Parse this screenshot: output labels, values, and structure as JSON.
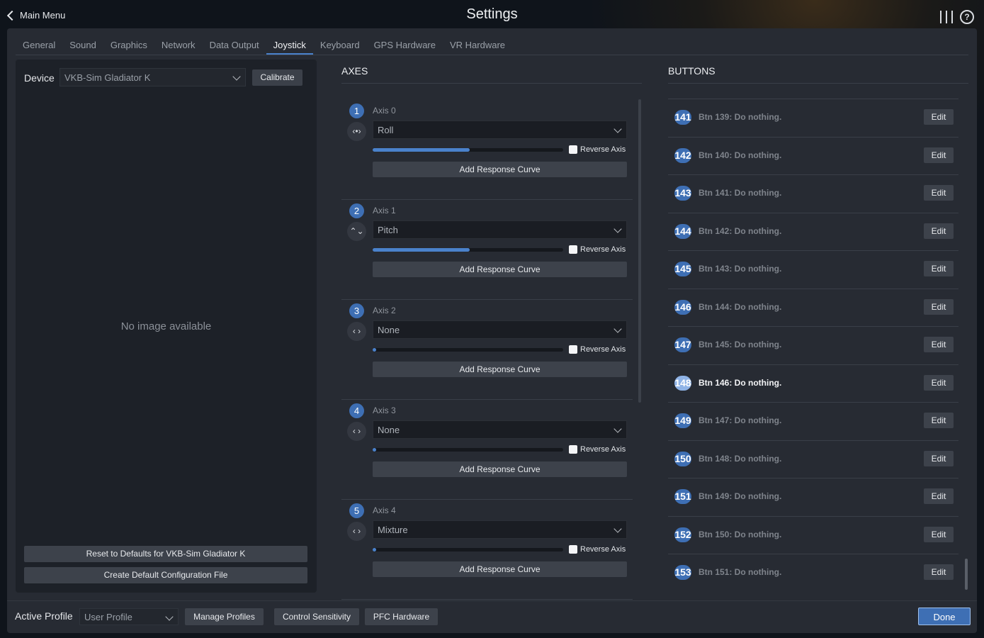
{
  "header": {
    "back_label": "Main Menu",
    "title": "Settings",
    "icons": [
      "sliders-icon",
      "help-icon"
    ]
  },
  "tabs": [
    {
      "label": "General",
      "active": false
    },
    {
      "label": "Sound",
      "active": false
    },
    {
      "label": "Graphics",
      "active": false
    },
    {
      "label": "Network",
      "active": false
    },
    {
      "label": "Data Output",
      "active": false
    },
    {
      "label": "Joystick",
      "active": true
    },
    {
      "label": "Keyboard",
      "active": false
    },
    {
      "label": "GPS Hardware",
      "active": false
    },
    {
      "label": "VR Hardware",
      "active": false
    }
  ],
  "device": {
    "label": "Device",
    "selected": "VKB-Sim Gladiator K",
    "calibrate_label": "Calibrate",
    "no_image": "No image available",
    "reset_label": "Reset to Defaults for VKB-Sim Gladiator K",
    "create_label": "Create Default Configuration File"
  },
  "axes": {
    "heading": "AXES",
    "reverse_label": "Reverse Axis",
    "curve_label": "Add Response Curve",
    "items": [
      {
        "num": "1",
        "name": "Axis 0",
        "dir": "‹•›",
        "value": "Roll",
        "level": 0.51
      },
      {
        "num": "2",
        "name": "Axis 1",
        "dir": "⌃⌄",
        "value": "Pitch",
        "level": 0.51
      },
      {
        "num": "3",
        "name": "Axis 2",
        "dir": "‹ ›",
        "value": "None",
        "level": 0.02
      },
      {
        "num": "4",
        "name": "Axis 3",
        "dir": "‹ ›",
        "value": "None",
        "level": 0.02
      },
      {
        "num": "5",
        "name": "Axis 4",
        "dir": "‹ ›",
        "value": "Mixture",
        "level": 0.02
      }
    ]
  },
  "buttons": {
    "heading": "BUTTONS",
    "edit_label": "Edit",
    "items": [
      {
        "num": "141",
        "label": "Btn 139: Do nothing.",
        "highlight": false
      },
      {
        "num": "142",
        "label": "Btn 140: Do nothing.",
        "highlight": false
      },
      {
        "num": "143",
        "label": "Btn 141: Do nothing.",
        "highlight": false
      },
      {
        "num": "144",
        "label": "Btn 142: Do nothing.",
        "highlight": false
      },
      {
        "num": "145",
        "label": "Btn 143: Do nothing.",
        "highlight": false
      },
      {
        "num": "146",
        "label": "Btn 144: Do nothing.",
        "highlight": false
      },
      {
        "num": "147",
        "label": "Btn 145: Do nothing.",
        "highlight": false
      },
      {
        "num": "148",
        "label": "Btn 146: Do nothing.",
        "highlight": true
      },
      {
        "num": "149",
        "label": "Btn 147: Do nothing.",
        "highlight": false
      },
      {
        "num": "150",
        "label": "Btn 148: Do nothing.",
        "highlight": false
      },
      {
        "num": "151",
        "label": "Btn 149: Do nothing.",
        "highlight": false
      },
      {
        "num": "152",
        "label": "Btn 150: Do nothing.",
        "highlight": false
      },
      {
        "num": "153",
        "label": "Btn 151: Do nothing.",
        "highlight": false
      }
    ]
  },
  "footer": {
    "active_profile_label": "Active Profile",
    "profile_selected": "User Profile",
    "manage_label": "Manage Profiles",
    "sensitivity_label": "Control Sensitivity",
    "pfc_label": "PFC Hardware",
    "done_label": "Done"
  },
  "colors": {
    "accent": "#3e6fb4",
    "panel": "#272b33"
  }
}
